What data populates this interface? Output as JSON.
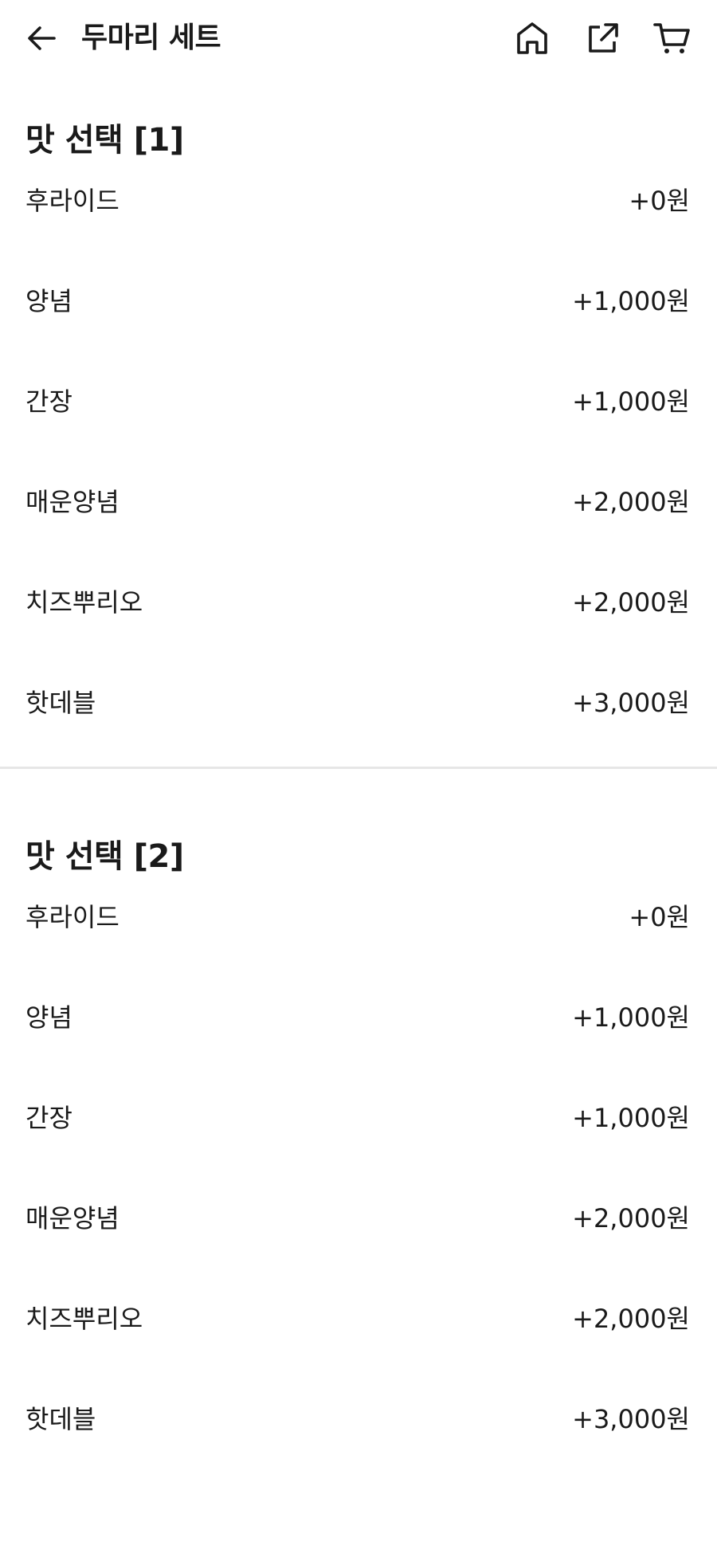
{
  "header": {
    "title": "두마리 세트",
    "icons": [
      "back-arrow-icon",
      "home-icon",
      "share-icon",
      "cart-icon"
    ]
  },
  "sections": [
    {
      "title": "맛 선택 [1]",
      "options": [
        {
          "name": "후라이드",
          "price": "+0원"
        },
        {
          "name": "양념",
          "price": "+1,000원"
        },
        {
          "name": "간장",
          "price": "+1,000원"
        },
        {
          "name": "매운양념",
          "price": "+2,000원"
        },
        {
          "name": "치즈뿌리오",
          "price": "+2,000원"
        },
        {
          "name": "핫데블",
          "price": "+3,000원"
        }
      ]
    },
    {
      "title": "맛 선택 [2]",
      "options": [
        {
          "name": "후라이드",
          "price": "+0원"
        },
        {
          "name": "양념",
          "price": "+1,000원"
        },
        {
          "name": "간장",
          "price": "+1,000원"
        },
        {
          "name": "매운양념",
          "price": "+2,000원"
        },
        {
          "name": "치즈뿌리오",
          "price": "+2,000원"
        },
        {
          "name": "핫데블",
          "price": "+3,000원"
        }
      ]
    }
  ],
  "colors": {
    "text": "#1a1a1a",
    "divider": "#e6e6e6",
    "background": "#ffffff"
  }
}
